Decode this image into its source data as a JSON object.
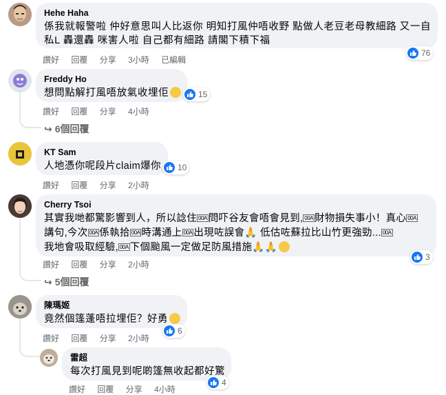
{
  "labels": {
    "like": "讚好",
    "reply": "回覆",
    "share": "分享",
    "edited": "已編輯"
  },
  "colors": {
    "accent": "#1877f2",
    "bubble": "#f0f2f5",
    "meta": "#65676b"
  },
  "comments": [
    {
      "author": "Hehe Haha",
      "text_line1": "係我就報警啦  仲好意思叫人比返你  明知打風仲唔收野  點做人老豆老母教細路  又一自",
      "text_line2": "私L 轟還轟  咪害人啦  自己都有細路  請閣下積下福",
      "time": "3小時",
      "edited": true,
      "reactions": "76"
    },
    {
      "author": "Freddy Ho",
      "text": "想問點解打風唔放氣收埋佢",
      "time": "4小時",
      "reactions": "15",
      "replies": "6個回覆"
    },
    {
      "author": "KT Sam",
      "text": "人地憑你呢段片claim爆你",
      "time": "2小時",
      "reactions": "10"
    },
    {
      "author": "Cherry Tsoi",
      "segments": [
        "其實我哋都驚影響到人，所以諗住",
        "問吓谷友會唔會見到,",
        "財物損失事小！真心",
        "講句,今次",
        "係執拾",
        "時溝通上",
        "出現咗誤會",
        " 低估咗蘇拉比山竹更強勁...",
        "我地會吸取經驗,",
        "下個颱風一定做足防風措施"
      ],
      "glyph": "00A",
      "time": "2小時",
      "reactions": "3",
      "replies": "5個回覆"
    },
    {
      "author": "陳瑪姬",
      "text": "竟然個篷蓬唔拉埋佢？好勇",
      "time": "2小時",
      "reactions": "6"
    },
    {
      "author": "雷超",
      "text": "每次打風見到呢啲篷無收起都好驚",
      "time": "4小時",
      "reactions": "4"
    }
  ]
}
